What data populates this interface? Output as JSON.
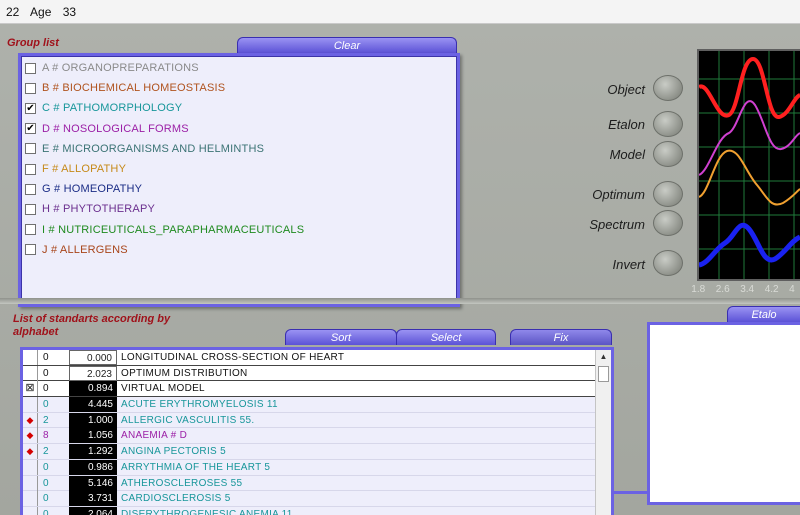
{
  "window": {
    "code": "22",
    "age_label": "Age",
    "age_value": "33"
  },
  "group_list": {
    "label": "Group list",
    "clear_tab": "Clear",
    "items": [
      {
        "text": "A # ORGANOPREPARATIONS",
        "checked": false,
        "color": "#8a8a8a"
      },
      {
        "text": "B # BIOCHEMICAL HOMEOSTASIS",
        "checked": false,
        "color": "#b0531e"
      },
      {
        "text": "C # PATHOMORPHOLOGY",
        "checked": true,
        "color": "#17969a"
      },
      {
        "text": "D # NOSOLOGICAL FORMS",
        "checked": true,
        "color": "#9b1fa6"
      },
      {
        "text": "E # MICROORGANISMS AND HELMINTHS",
        "checked": false,
        "color": "#3b7374"
      },
      {
        "text": "F # ALLOPATHY",
        "checked": false,
        "color": "#c68a19"
      },
      {
        "text": "G # HOMEOPATHY",
        "checked": false,
        "color": "#1b2d86"
      },
      {
        "text": "H # PHYTOTHERAPY",
        "checked": false,
        "color": "#6b2f8e"
      },
      {
        "text": "I # NUTRICEUTICALS_PARAPHARMACEUTICALS",
        "checked": false,
        "color": "#1f8a1f"
      },
      {
        "text": "J # ALLERGENS",
        "checked": false,
        "color": "#a8451a"
      }
    ]
  },
  "controls": {
    "object": "Object",
    "etalon": "Etalon",
    "model": "Model",
    "optimum": "Optimum",
    "spectrum": "Spectrum",
    "invert": "Invert"
  },
  "scope_ticks": [
    "1.8",
    "2.6",
    "3.4",
    "4.2",
    "4"
  ],
  "standards": {
    "label_line1": "List of standarts according by",
    "label_line2": "alphabet",
    "tabs": {
      "sort": "Sort",
      "select": "Select",
      "fix": "Fix"
    },
    "rows": [
      {
        "mark": "",
        "n": "0",
        "value": "0.000",
        "name": "LONGITUDINAL CROSS-SECTION OF HEART",
        "style": "head",
        "color": "#111111"
      },
      {
        "mark": "",
        "n": "0",
        "value": "2.023",
        "name": "OPTIMUM DISTRIBUTION",
        "style": "head",
        "color": "#111111"
      },
      {
        "mark": "⊠",
        "n": "0",
        "value": "0.894",
        "name": "VIRTUAL MODEL",
        "style": "head-black",
        "color": "#111111"
      },
      {
        "mark": "",
        "n": "0",
        "value": "4.445",
        "name": "ACUTE ERYTHROMYELOSIS 11",
        "style": "black",
        "color": "#17969a"
      },
      {
        "mark": "◆",
        "n": "2",
        "value": "1.000",
        "name": "ALLERGIC VASCULITIS 55.",
        "style": "black",
        "color": "#17969a"
      },
      {
        "mark": "◆",
        "n": "8",
        "value": "1.056",
        "name": "ANAEMIA # D",
        "style": "black",
        "color": "#9b1fa6"
      },
      {
        "mark": "◆",
        "n": "2",
        "value": "1.292",
        "name": "ANGINA PECTORIS 5",
        "style": "black",
        "color": "#17969a"
      },
      {
        "mark": "",
        "n": "0",
        "value": "0.986",
        "name": "ARRYTHMIA OF THE HEART 5",
        "style": "black",
        "color": "#17969a"
      },
      {
        "mark": "",
        "n": "0",
        "value": "5.146",
        "name": "ATHEROSCLEROSES 55",
        "style": "black",
        "color": "#17969a"
      },
      {
        "mark": "",
        "n": "0",
        "value": "3.731",
        "name": "CARDIOSCLEROSIS 5",
        "style": "black",
        "color": "#17969a"
      },
      {
        "mark": "",
        "n": "0",
        "value": "2.064",
        "name": "DISERYTHROGENESIC ANEMIA 11",
        "style": "black",
        "color": "#17969a"
      }
    ]
  },
  "etalon_panel": {
    "tab": "Etalo"
  }
}
